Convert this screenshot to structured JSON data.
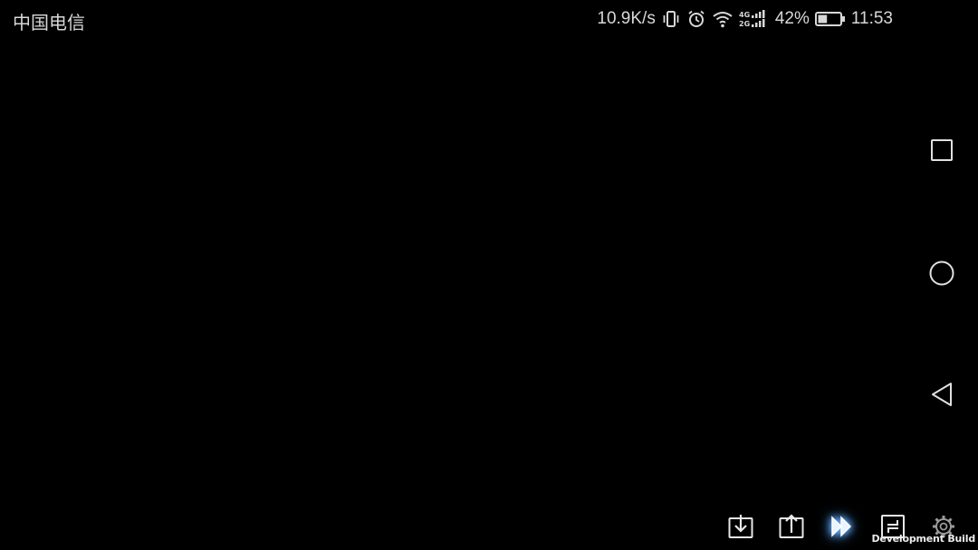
{
  "status_bar": {
    "carrier": "中国电信",
    "net_speed": "10.9K/s",
    "battery_percent": "42%",
    "battery_level": 0.42,
    "time": "11:53",
    "icons": [
      "vibrate-icon",
      "alarm-icon",
      "wifi-icon",
      "signal-4g-2g-icon",
      "battery-icon"
    ]
  },
  "nav_bar": {
    "buttons": [
      "recent-apps-icon",
      "home-icon",
      "back-icon"
    ]
  },
  "toolbar": {
    "buttons": [
      "download-icon",
      "upload-icon",
      "fast-forward-icon",
      "swap-icon",
      "settings-icon"
    ],
    "active": "fast-forward-icon",
    "dev_build_label": "Development Build"
  },
  "colors": {
    "background": "#000000",
    "foreground": "#d8d8d8",
    "accent_glow": "#6fb8ff"
  }
}
